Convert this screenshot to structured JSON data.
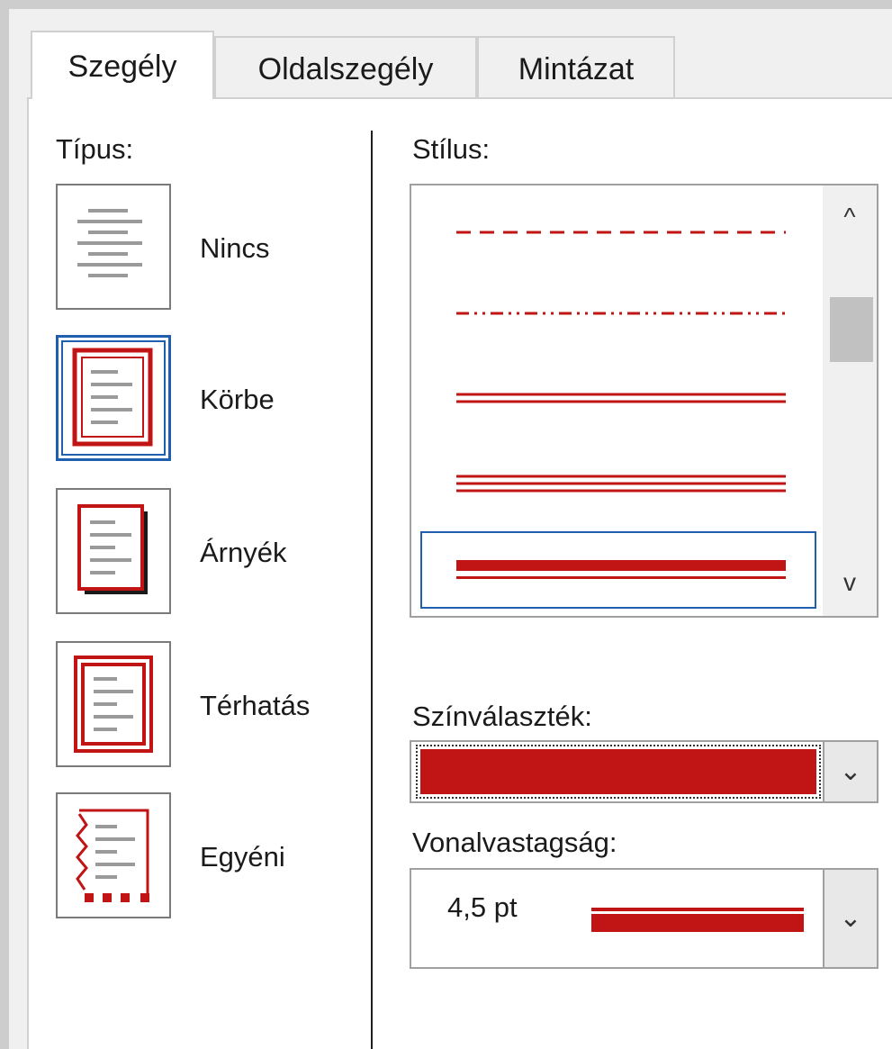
{
  "tabs": [
    {
      "label": "Szegély",
      "active": true
    },
    {
      "label": "Oldalszegély",
      "active": false
    },
    {
      "label": "Mintázat",
      "active": false
    }
  ],
  "type_section": {
    "label": "Típus:",
    "items": [
      {
        "name": "Nincs",
        "selected": false
      },
      {
        "name": "Körbe",
        "selected": true
      },
      {
        "name": "Árnyék",
        "selected": false
      },
      {
        "name": "Térhatás",
        "selected": false
      },
      {
        "name": "Egyéni",
        "selected": false
      }
    ]
  },
  "style_section": {
    "label": "Stílus:",
    "scroll_up": "^",
    "scroll_down": "v"
  },
  "color_section": {
    "label": "Színválaszték:",
    "value_color": "#c11515"
  },
  "weight_section": {
    "label": "Vonalvastagság:",
    "value": "4,5 pt"
  },
  "colors": {
    "accent_red": "#c11515",
    "selection_blue": "#1f5fae"
  }
}
